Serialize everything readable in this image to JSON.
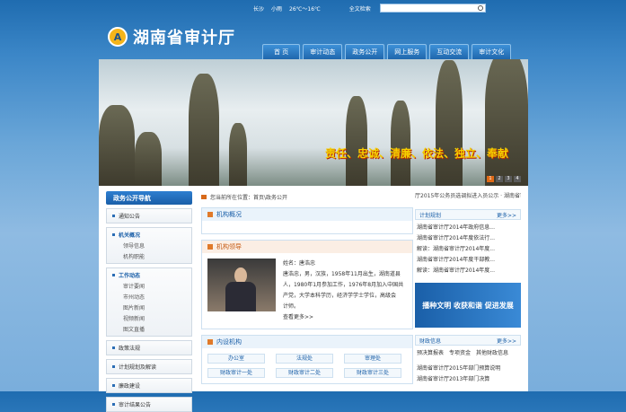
{
  "topbar": {
    "city": "长沙",
    "weather": "小雨",
    "temp": "26℃～16℃",
    "search_label": "全文检索"
  },
  "header": {
    "site_title": "湖南省审计厅",
    "logo_mark": "A"
  },
  "nav": [
    "首 页",
    "审计动态",
    "政务公开",
    "网上服务",
    "互动交流",
    "审计文化"
  ],
  "banner": {
    "slogan": "责任、忠诚、清廉、依法、独立、奉献",
    "dots": [
      "1",
      "2",
      "3",
      "4"
    ]
  },
  "sidebar": {
    "title": "政务公开导航",
    "items": [
      {
        "label": "通知公告",
        "sub": []
      },
      {
        "label": "机关概况",
        "sub": [
          "领导信息",
          "机构职能"
        ]
      },
      {
        "label": "工作动态",
        "sub": [
          "审计要闻",
          "市州动态",
          "图片新闻",
          "视频新闻",
          "图文直播"
        ]
      },
      {
        "label": "政策法规",
        "sub": []
      },
      {
        "label": "计划规划及解读",
        "sub": []
      },
      {
        "label": "廉政建设",
        "sub": []
      },
      {
        "label": "审计结果公告",
        "sub": []
      }
    ]
  },
  "breadcrumb": {
    "label": "您当前所在位置：首页\\政务公开"
  },
  "main": {
    "org_overview": "机构概况",
    "leader_title": "机构领导",
    "leader_bio": [
      "姓名：唐浩忠",
      "唐浩忠，男，汉族，1958年11月出生，湖南道县",
      "人，1980年1月参加工作，1976年8月加入中国共",
      "产党，大学本科学历，经济学学士学位，高级会",
      "计师。"
    ],
    "more": "查看更多>>",
    "internal_title": "内设机构",
    "internal_units": [
      "办公室",
      "法规处",
      "审理处",
      "财政审计一处",
      "财政审计二处",
      "财政审计三处"
    ]
  },
  "right": {
    "ticker": "厅2015年公务员选调拟进入员公示 · 湖南省审计厅",
    "plan_title": "计划规划",
    "more_label": "更多>>",
    "plan_items": [
      "湖南省审计厅2014年政府信息...",
      "湖南省审计厅2014年度依法行...",
      "解读：湖南省审计厅2014年度...",
      "湖南省审计厅2014年度干部教...",
      "解读：湖南省审计厅2014年度..."
    ],
    "promo": "播种文明 收获和谐 促进发展",
    "finance_title": "财政信息",
    "finance_links": "预决算报表　专项资金　其他财政信息",
    "finance_items": [
      "湖南省审计厅2015年部门预算说明",
      "湖南省审计厅2013年部门决算"
    ]
  }
}
